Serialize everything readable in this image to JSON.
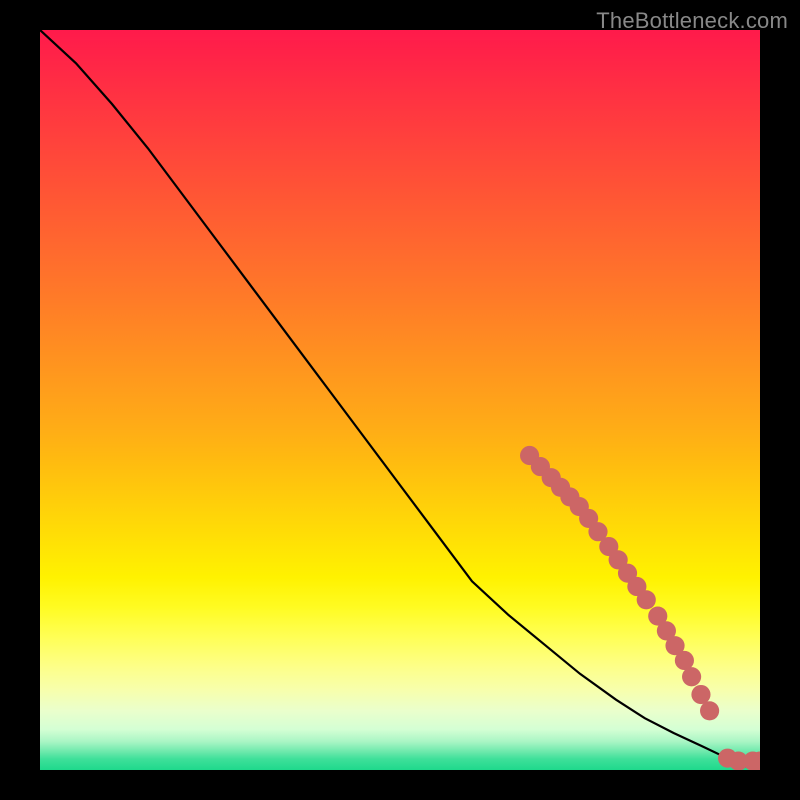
{
  "attribution": "TheBottleneck.com",
  "colors": {
    "page_bg": "#000000",
    "line": "#000000",
    "marker": "#cc6666",
    "gradient_stops": [
      {
        "offset": 0.0,
        "color": "#ff1a4b"
      },
      {
        "offset": 0.06,
        "color": "#ff2a45"
      },
      {
        "offset": 0.12,
        "color": "#ff3a3f"
      },
      {
        "offset": 0.18,
        "color": "#ff4a39"
      },
      {
        "offset": 0.24,
        "color": "#ff5a33"
      },
      {
        "offset": 0.3,
        "color": "#ff6a2e"
      },
      {
        "offset": 0.36,
        "color": "#ff7a28"
      },
      {
        "offset": 0.42,
        "color": "#ff8b22"
      },
      {
        "offset": 0.48,
        "color": "#ff9c1c"
      },
      {
        "offset": 0.54,
        "color": "#ffad16"
      },
      {
        "offset": 0.58,
        "color": "#ffba10"
      },
      {
        "offset": 0.62,
        "color": "#ffc80c"
      },
      {
        "offset": 0.66,
        "color": "#ffd608"
      },
      {
        "offset": 0.7,
        "color": "#ffe404"
      },
      {
        "offset": 0.74,
        "color": "#fff200"
      },
      {
        "offset": 0.78,
        "color": "#fffb22"
      },
      {
        "offset": 0.82,
        "color": "#ffff55"
      },
      {
        "offset": 0.86,
        "color": "#fdff88"
      },
      {
        "offset": 0.89,
        "color": "#f8ffaa"
      },
      {
        "offset": 0.92,
        "color": "#eaffcc"
      },
      {
        "offset": 0.945,
        "color": "#d4ffd4"
      },
      {
        "offset": 0.962,
        "color": "#a8f5c4"
      },
      {
        "offset": 0.975,
        "color": "#6ee9ac"
      },
      {
        "offset": 0.985,
        "color": "#3fe09a"
      },
      {
        "offset": 1.0,
        "color": "#1ed98c"
      }
    ]
  },
  "chart_data": {
    "type": "line",
    "title": "",
    "xlabel": "",
    "ylabel": "",
    "xlim": [
      0,
      100
    ],
    "ylim": [
      0,
      100
    ],
    "series": [
      {
        "name": "curve",
        "x": [
          0,
          5,
          10,
          15,
          20,
          25,
          30,
          35,
          40,
          45,
          50,
          55,
          60,
          65,
          70,
          75,
          80,
          84,
          88,
          92,
          95,
          97,
          98.5,
          100
        ],
        "y": [
          100,
          95.5,
          90,
          84,
          77.5,
          71,
          64.5,
          58,
          51.5,
          45,
          38.5,
          32,
          25.5,
          21,
          17,
          13,
          9.5,
          7,
          5,
          3.2,
          1.8,
          0.9,
          0.3,
          0.2
        ]
      }
    ],
    "markers": [
      {
        "x": 68.0,
        "y": 42.5,
        "r": 1.4
      },
      {
        "x": 69.5,
        "y": 41.0,
        "r": 1.4
      },
      {
        "x": 71.0,
        "y": 39.5,
        "r": 1.4
      },
      {
        "x": 72.3,
        "y": 38.2,
        "r": 1.4
      },
      {
        "x": 73.6,
        "y": 36.9,
        "r": 1.4
      },
      {
        "x": 74.9,
        "y": 35.6,
        "r": 1.4
      },
      {
        "x": 76.2,
        "y": 34.0,
        "r": 1.4
      },
      {
        "x": 77.5,
        "y": 32.2,
        "r": 1.4
      },
      {
        "x": 79.0,
        "y": 30.2,
        "r": 1.4
      },
      {
        "x": 80.3,
        "y": 28.4,
        "r": 1.4
      },
      {
        "x": 81.6,
        "y": 26.6,
        "r": 1.4
      },
      {
        "x": 82.9,
        "y": 24.8,
        "r": 1.4
      },
      {
        "x": 84.2,
        "y": 23.0,
        "r": 1.4
      },
      {
        "x": 85.8,
        "y": 20.8,
        "r": 1.4
      },
      {
        "x": 87.0,
        "y": 18.8,
        "r": 1.4
      },
      {
        "x": 88.2,
        "y": 16.8,
        "r": 1.4
      },
      {
        "x": 89.5,
        "y": 14.8,
        "r": 1.4
      },
      {
        "x": 90.5,
        "y": 12.6,
        "r": 1.4
      },
      {
        "x": 91.8,
        "y": 10.2,
        "r": 1.4
      },
      {
        "x": 93.0,
        "y": 8.0,
        "r": 1.4
      },
      {
        "x": 95.5,
        "y": 1.6,
        "r": 1.4
      },
      {
        "x": 97.0,
        "y": 1.2,
        "r": 1.4
      },
      {
        "x": 99.0,
        "y": 1.2,
        "r": 1.4
      },
      {
        "x": 100.0,
        "y": 1.2,
        "r": 1.4
      }
    ]
  }
}
